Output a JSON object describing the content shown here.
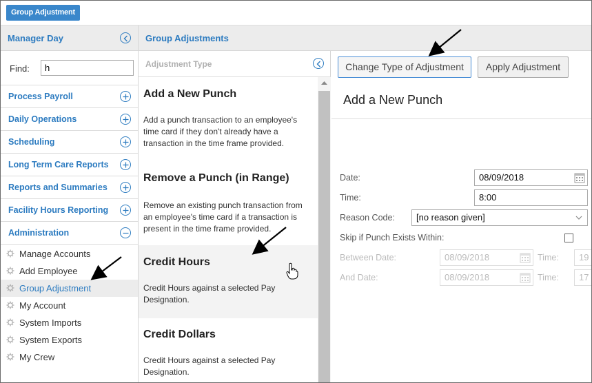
{
  "topbar": {
    "tab_label": "Group Adjustment"
  },
  "header": {
    "left_title": "Manager Day",
    "right_title": "Group Adjustments"
  },
  "sidebar": {
    "find_label": "Find:",
    "find_value": "h",
    "menu": [
      {
        "label": "Process Payroll",
        "icon": "plus-circle-icon"
      },
      {
        "label": "Daily Operations",
        "icon": "plus-circle-icon"
      },
      {
        "label": "Scheduling",
        "icon": "plus-circle-icon"
      },
      {
        "label": "Long Term Care Reports",
        "icon": "plus-circle-icon"
      },
      {
        "label": "Reports and Summaries",
        "icon": "plus-circle-icon"
      },
      {
        "label": "Facility Hours Reporting",
        "icon": "plus-circle-icon"
      },
      {
        "label": "Administration",
        "icon": "minus-circle-icon"
      }
    ],
    "sub_items": [
      {
        "label": "Manage Accounts"
      },
      {
        "label": "Add Employee"
      },
      {
        "label": "Group Adjustment"
      },
      {
        "label": "My Account"
      },
      {
        "label": "System Imports"
      },
      {
        "label": "System Exports"
      },
      {
        "label": "My Crew"
      }
    ]
  },
  "middle": {
    "title": "Adjustment Type",
    "items": [
      {
        "name": "Add a New Punch",
        "desc": "Add a punch transaction to an employee's time card if they don't already have a transaction in the time frame provided."
      },
      {
        "name": "Remove a Punch (in Range)",
        "desc": "Remove an existing punch transaction from an employee's time card if a transaction is present in the time frame provided."
      },
      {
        "name": "Credit Hours",
        "desc": "Credit Hours against a selected Pay Designation."
      },
      {
        "name": "Credit Dollars",
        "desc": "Credit Hours against a selected Pay Designation."
      }
    ]
  },
  "right": {
    "change_button": "Change Type of Adjustment",
    "apply_button": "Apply Adjustment",
    "panel_title": "Add a New Punch",
    "date_label": "Date:",
    "date_value": "08/09/2018",
    "time_label": "Time:",
    "time_value": "8:00",
    "reason_label": "Reason Code:",
    "reason_value": "[no reason given]",
    "skip_label": "Skip if Punch Exists Within:",
    "between_label": "Between Date:",
    "between_value": "08/09/2018",
    "between_time_label": "Time:",
    "between_time_value": "19",
    "and_label": "And Date:",
    "and_value": "08/09/2018",
    "and_time_label": "Time:",
    "and_time_value": "17"
  },
  "colors": {
    "accent": "#2c7bc0",
    "tab_bg": "#3a87cb",
    "arrow": "#000000"
  }
}
